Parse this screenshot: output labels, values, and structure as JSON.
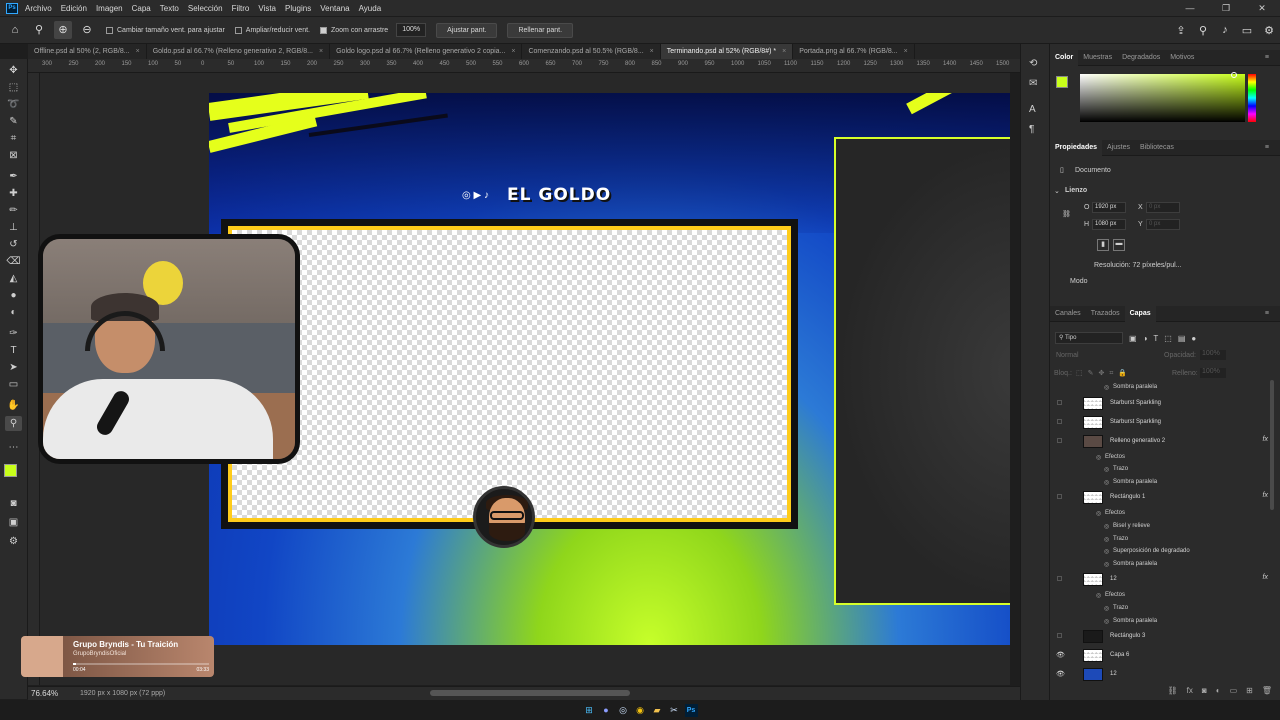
{
  "menu": [
    "Archivo",
    "Edición",
    "Imagen",
    "Capa",
    "Texto",
    "Selección",
    "Filtro",
    "Vista",
    "Plugins",
    "Ventana",
    "Ayuda"
  ],
  "window_controls": [
    "—",
    "❐",
    "✕"
  ],
  "options": {
    "resize_windows": "Cambiar tamaño vent. para ajustar",
    "zoom_all": "Ampliar/reducir vent.",
    "scrubby_zoom": "Zoom con arrastre",
    "zoom_value": "100%",
    "fit_screen": "Ajustar pant.",
    "fill_screen": "Rellenar pant."
  },
  "tabs": [
    {
      "label": "Offline.psd al 50% (2, RGB/8...",
      "active": false
    },
    {
      "label": "Goldo.psd al 66.7% (Relleno generativo 2, RGB/8...",
      "active": false
    },
    {
      "label": "Goldo logo.psd al 66.7% (Relleno generativo 2 copia...",
      "active": false
    },
    {
      "label": "Comenzando.psd al 50.5% (RGB/8...",
      "active": false
    },
    {
      "label": "Terminando.psd al 52% (RGB/8#) *",
      "active": true
    },
    {
      "label": "Portada.png al 66.7% (RGB/8...",
      "active": false
    }
  ],
  "ruler": [
    "300",
    "250",
    "200",
    "150",
    "100",
    "50",
    "0",
    "50",
    "100",
    "150",
    "200",
    "250",
    "300",
    "350",
    "400",
    "450",
    "500",
    "550",
    "600",
    "650",
    "700",
    "750",
    "800",
    "850",
    "900",
    "950",
    "1000",
    "1050",
    "1100",
    "1150",
    "1200",
    "1250",
    "1300",
    "1350",
    "1400",
    "1450",
    "1500"
  ],
  "canvas": {
    "brand_text": "EL GOLDO",
    "social_icons": "◎ ▶ ♪"
  },
  "media_player": {
    "title": "Grupo Bryndis - Tu Traición",
    "artist": "GrupoBryndisOficial",
    "time_current": "00:04",
    "time_total": "03:33",
    "progress": 0.02
  },
  "status": {
    "zoom": "76.64%",
    "doc_info": "1920 px x 1080 px (72 ppp)"
  },
  "color_panel": {
    "tabs": [
      "Color",
      "Muestras",
      "Degradados",
      "Motivos"
    ],
    "foreground": "#c8ff1a"
  },
  "properties_panel": {
    "tabs": [
      "Propiedades",
      "Ajustes",
      "Bibliotecas"
    ],
    "type": "Documento",
    "section": "Lienzo",
    "width_label": "O",
    "width": "1920 px",
    "x_label": "X",
    "x_value": "0 px",
    "height_label": "H",
    "height": "1080 px",
    "y_label": "Y",
    "y_value": "0 px",
    "resolution": "Resolución: 72 píxeles/pul...",
    "mode": "Modo"
  },
  "layers_panel": {
    "tabs": [
      "Canales",
      "Trazados",
      "Capas"
    ],
    "filter": "Tipo",
    "blend": "Normal",
    "opacity_label": "Opacidad:",
    "opacity": "100%",
    "lock_label": "Bloq.:",
    "fill_label": "Relleno:",
    "fill": "100%",
    "rows": [
      {
        "kind": "effect",
        "label": "Sombra paralela",
        "indent": 2
      },
      {
        "kind": "layer",
        "label": "Starburst Sparkling",
        "thumb": "checker",
        "visible": false,
        "fx": false
      },
      {
        "kind": "layer",
        "label": "Starburst Sparkling",
        "thumb": "checker",
        "visible": false,
        "fx": false
      },
      {
        "kind": "layer",
        "label": "Relleno generativo 2",
        "thumb": "photo",
        "visible": false,
        "fx": true
      },
      {
        "kind": "effect",
        "label": "Efectos",
        "indent": 1
      },
      {
        "kind": "effect",
        "label": "Trazo",
        "indent": 2
      },
      {
        "kind": "effect",
        "label": "Sombra paralela",
        "indent": 2
      },
      {
        "kind": "layer",
        "label": "Rectángulo 1",
        "thumb": "checker",
        "visible": false,
        "fx": true
      },
      {
        "kind": "effect",
        "label": "Efectos",
        "indent": 1
      },
      {
        "kind": "effect",
        "label": "Bisel y relieve",
        "indent": 2
      },
      {
        "kind": "effect",
        "label": "Trazo",
        "indent": 2
      },
      {
        "kind": "effect",
        "label": "Superposición de degradado",
        "indent": 2
      },
      {
        "kind": "effect",
        "label": "Sombra paralela",
        "indent": 2
      },
      {
        "kind": "layer",
        "label": "12",
        "thumb": "checker",
        "visible": false,
        "fx": true
      },
      {
        "kind": "effect",
        "label": "Efectos",
        "indent": 1
      },
      {
        "kind": "effect",
        "label": "Trazo",
        "indent": 2
      },
      {
        "kind": "effect",
        "label": "Sombra paralela",
        "indent": 2
      },
      {
        "kind": "layer",
        "label": "Rectángulo 3",
        "thumb": "dark",
        "visible": false,
        "fx": false
      },
      {
        "kind": "layer",
        "label": "Capa 6",
        "thumb": "checker",
        "visible": true,
        "fx": false
      },
      {
        "kind": "layer",
        "label": "12",
        "thumb": "blue",
        "visible": true,
        "fx": false
      }
    ],
    "fx_label": "fx"
  }
}
